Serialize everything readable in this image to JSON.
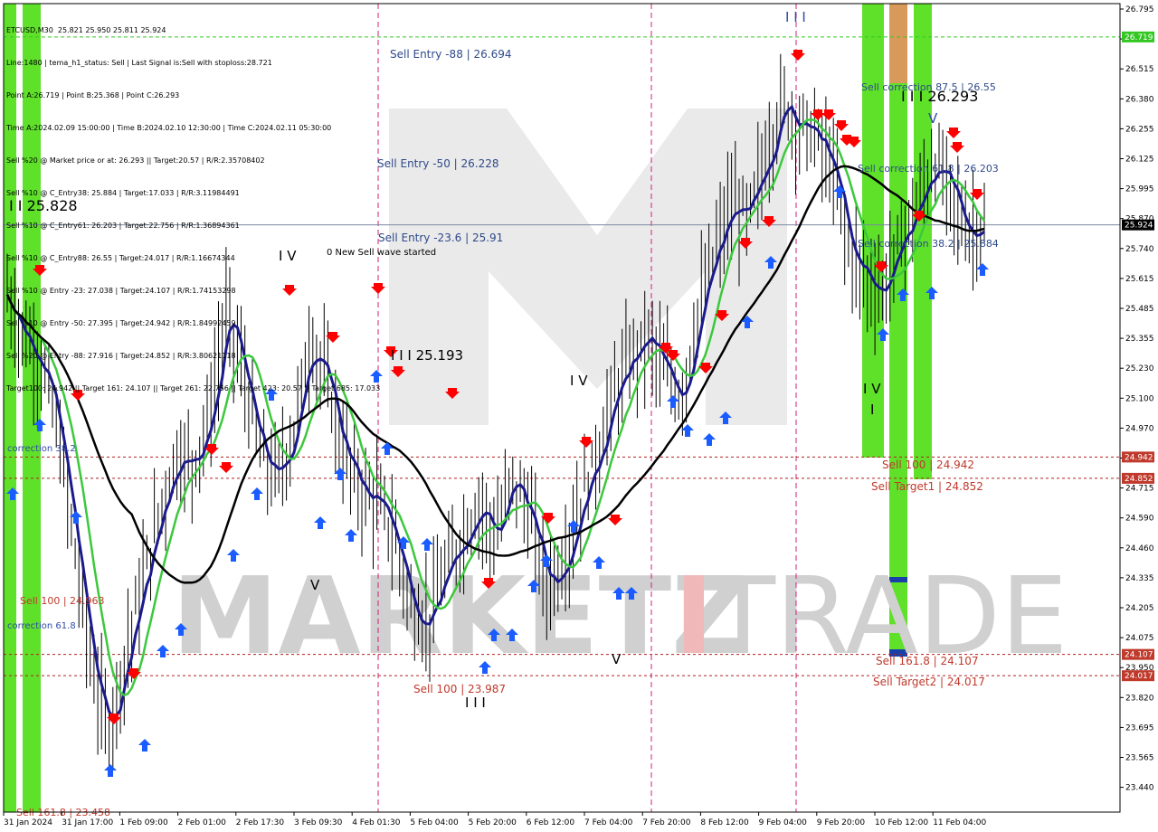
{
  "symbol_header": "ETCUSD,M30  25.821 25.950 25.811 25.924",
  "info_lines": [
    "Line:1480 | tema_h1_status: Sell | Last Signal is:Sell with stoploss:28.721",
    "Point A:26.719 | Point B:25.368 | Point C:26.293",
    "Time A:2024.02.09 15:00:00 | Time B:2024.02.10 12:30:00 | Time C:2024.02.11 05:30:00",
    "Sell %20 @ Market price or at: 26.293 || Target:20.57 | R/R:2.35708402",
    "Sell %10 @ C_Entry38: 25.884 | Target:17.033 | R/R:3.11984491",
    "Sell %10 @ C_Entry61: 26.203 | Target:22.756 | R/R:1.36894361",
    "Sell %10 @ C_Entry88: 26.55 | Target:24.017 | R/R:1.16674344",
    "Sell %10 @ Entry -23: 27.038 | Target:24.107 | R/R:1.74153298",
    "Sell %10 @ Entry -50: 27.395 | Target:24.942 | R/R:1.84992459",
    "Sell %20 @ Entry -88: 27.916 | Target:24.852 | R/R:3.80621118",
    "Target100: 24.942 || Target 161: 24.107 || Target 261: 22.756 || Target 423: 20.57 || Target 685: 17.033"
  ],
  "price_axis": [
    "26.795",
    "26.660",
    "26.515",
    "26.380",
    "26.255",
    "26.125",
    "25.995",
    "25.870",
    "25.740",
    "25.615",
    "25.485",
    "25.355",
    "25.230",
    "25.100",
    "24.970",
    "24.840",
    "24.715",
    "24.590",
    "24.460",
    "24.335",
    "24.205",
    "24.075",
    "23.950",
    "23.820",
    "23.695",
    "23.565",
    "23.440"
  ],
  "price_tags": [
    {
      "label": "26.719",
      "value": 26.719,
      "color": "#34c724"
    },
    {
      "label": "25.924",
      "value": 25.924,
      "color": "#000000"
    },
    {
      "label": "24.942",
      "value": 24.942,
      "color": "#c0392b"
    },
    {
      "label": "24.852",
      "value": 24.852,
      "color": "#c0392b"
    },
    {
      "label": "24.107",
      "value": 24.107,
      "color": "#c0392b"
    },
    {
      "label": "24.017",
      "value": 24.017,
      "color": "#c0392b"
    }
  ],
  "time_axis": [
    "31 Jan 2024",
    "31 Jan 17:00",
    "1 Feb 09:00",
    "2 Feb 01:00",
    "2 Feb 17:30",
    "3 Feb 09:30",
    "4 Feb 01:30",
    "5 Feb 04:00",
    "5 Feb 20:00",
    "6 Feb 12:00",
    "7 Feb 04:00",
    "7 Feb 20:00",
    "8 Feb 12:00",
    "9 Feb 04:00",
    "9 Feb 20:00",
    "10 Feb 12:00",
    "11 Feb 04:00"
  ],
  "watermark": {
    "left": "MARKETZ",
    "mid": "I",
    "right": "TRADE"
  },
  "annotations": [
    {
      "text": "Sell Entry -88 | 26.694",
      "color": "#2e4a8a"
    },
    {
      "text": "Sell Entry -50 | 26.228",
      "color": "#2e4a8a"
    },
    {
      "text": "Sell Entry -23.6 | 25.91",
      "color": "#2e4a8a"
    },
    {
      "text": "0 New Sell wave started",
      "color": "#000000"
    },
    {
      "text": "I I 25.828",
      "color": "#000000"
    },
    {
      "text": "I I I 25.193",
      "color": "#000000"
    },
    {
      "text": "I V",
      "color": "#000000"
    },
    {
      "text": "I V",
      "color": "#000000"
    },
    {
      "text": "V",
      "color": "#000000"
    },
    {
      "text": "V",
      "color": "#000000"
    },
    {
      "text": "I I I",
      "color": "#000000"
    },
    {
      "text": "I I I",
      "color": "#2e4aa8"
    },
    {
      "text": "Sell 100 | 23.987",
      "color": "#c0392b"
    },
    {
      "text": "correction 38.2",
      "color": "#2e4aa8"
    },
    {
      "text": "correction 61.8",
      "color": "#2e4aa8"
    },
    {
      "text": "Sell 100 | 24.963",
      "color": "#c0392b"
    },
    {
      "text": "Sell 161.8 | 23.458",
      "color": "#c0392b"
    },
    {
      "text": "Sell correction 87.5 | 26.55",
      "color": "#2e4a8a"
    },
    {
      "text": "I I I 26.293",
      "color": "#000000"
    },
    {
      "text": "Sell correction 61.8 | 26.203",
      "color": "#2e4a8a"
    },
    {
      "text": "Sell correction 38.2 | 25.884",
      "color": "#2e4a8a"
    },
    {
      "text": "Sell 100 | 24.942",
      "color": "#c0392b"
    },
    {
      "text": "Sell Target1 | 24.852",
      "color": "#c0392b"
    },
    {
      "text": "Sell 161.8 | 24.107",
      "color": "#c0392b"
    },
    {
      "text": "Sell Target2 | 24.017",
      "color": "#c0392b"
    },
    {
      "text": "I V",
      "color": "#000000"
    },
    {
      "text": "I",
      "color": "#000000"
    },
    {
      "text": "V",
      "color": "#2e4aa8"
    }
  ],
  "colors": {
    "bull": "#000000",
    "bear": "#000000",
    "ma_blue": "#1a1a8c",
    "ma_green": "#3cc83c",
    "ma_black": "#000000",
    "zone_green": "#5fe12a",
    "zone_orange": "#d89a5a",
    "zone_blue": "#1a3fa8",
    "sell_arrow": "#ff0000",
    "buy_arrow": "#1a5cff",
    "vline": "#d0207a"
  },
  "chart_data": {
    "type": "candlestick",
    "title": "ETCUSD,M30",
    "last_price": 25.924,
    "ylim": [
      23.44,
      26.86
    ],
    "x": [
      "31 Jan 2024",
      "31 Jan 17:00",
      "1 Feb 09:00",
      "2 Feb 01:00",
      "2 Feb 17:30",
      "3 Feb 09:30",
      "4 Feb 01:30",
      "5 Feb 04:00",
      "5 Feb 20:00",
      "6 Feb 12:00",
      "7 Feb 04:00",
      "7 Feb 20:00",
      "8 Feb 12:00",
      "9 Feb 04:00",
      "9 Feb 20:00",
      "10 Feb 12:00",
      "11 Feb 04:00"
    ],
    "close_path": [
      25.63,
      25.45,
      25.35,
      25.05,
      24.55,
      24.05,
      23.78,
      24.1,
      24.4,
      24.7,
      24.95,
      24.92,
      25.1,
      25.55,
      25.3,
      24.95,
      24.85,
      25.05,
      25.45,
      25.25,
      24.95,
      24.8,
      24.75,
      24.6,
      24.3,
      24.25,
      24.45,
      24.6,
      24.75,
      24.6,
      24.85,
      24.7,
      24.4,
      24.5,
      24.75,
      24.95,
      25.2,
      25.35,
      25.45,
      25.3,
      25.2,
      25.55,
      25.8,
      26.0,
      25.95,
      26.2,
      26.45,
      26.35,
      26.3,
      26.15,
      25.8,
      25.7,
      25.65,
      25.85,
      26.0,
      26.2,
      26.05,
      25.9,
      25.92
    ],
    "levels": [
      {
        "name": "Sell Entry -88",
        "value": 26.694
      },
      {
        "name": "Sell Entry -50",
        "value": 26.228
      },
      {
        "name": "Sell Entry -23.6",
        "value": 25.91
      },
      {
        "name": "Sell 100",
        "value": 24.942
      },
      {
        "name": "Sell Target1",
        "value": 24.852
      },
      {
        "name": "Sell 161.8",
        "value": 24.107
      },
      {
        "name": "Sell Target2",
        "value": 24.017
      }
    ]
  }
}
